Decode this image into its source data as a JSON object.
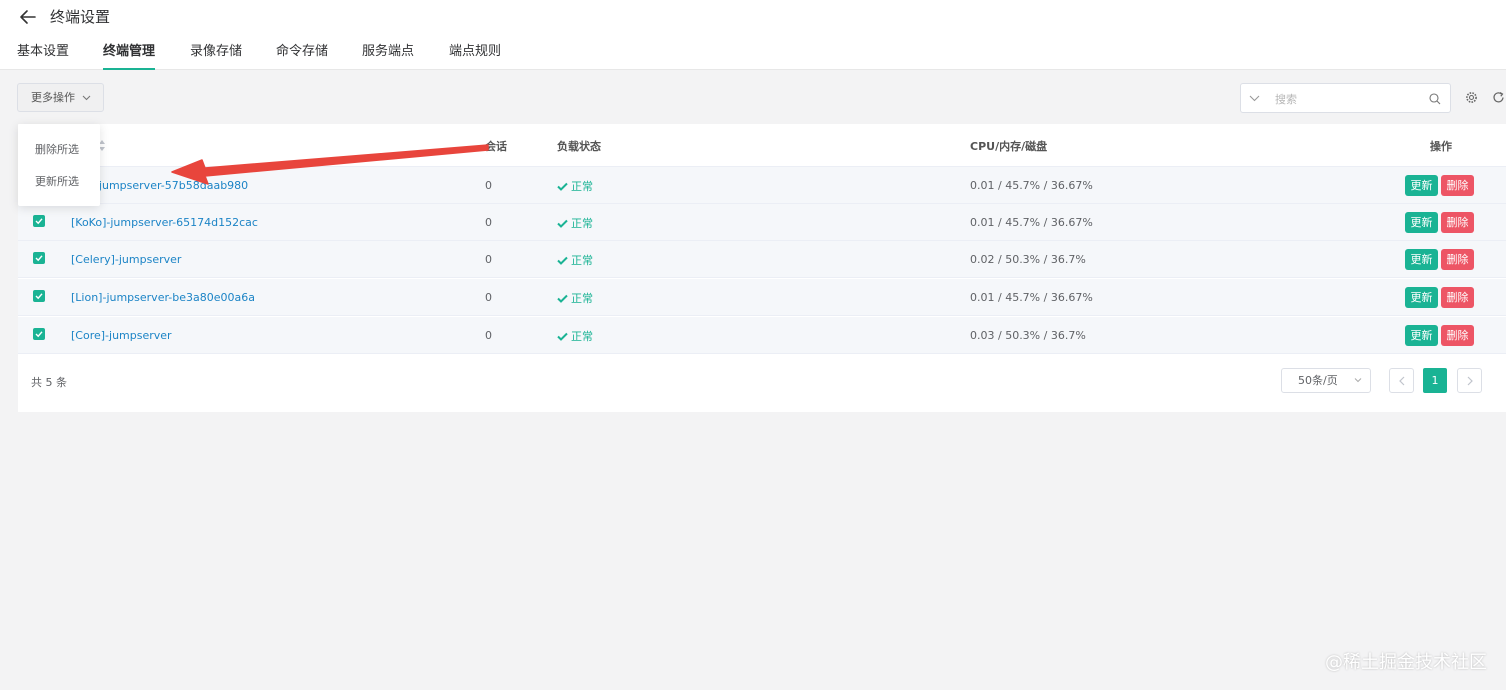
{
  "header": {
    "title": "终端设置",
    "tabs": [
      "基本设置",
      "终端管理",
      "录像存储",
      "命令存储",
      "服务端点",
      "端点规则"
    ],
    "active_tab": "终端管理"
  },
  "toolbar": {
    "more_actions_label": "更多操作",
    "search_placeholder": "搜索"
  },
  "dropdown": {
    "items": [
      "删除所选",
      "更新所选"
    ]
  },
  "table": {
    "columns": {
      "sessions": "会话",
      "status": "负载状态",
      "resources": "CPU/内存/磁盘",
      "actions": "操作"
    },
    "rows": [
      {
        "name": "[Magnus]-jumpserver-57b58daab980",
        "name_visible": "nus]-jumpserver-57b58daab980",
        "sessions": "0",
        "status": "正常",
        "resources": "0.01 / 45.7% / 36.67%",
        "checked": true
      },
      {
        "name": "[KoKo]-jumpserver-65174d152cac",
        "sessions": "0",
        "status": "正常",
        "resources": "0.01 / 45.7% / 36.67%",
        "checked": true
      },
      {
        "name": "[Celery]-jumpserver",
        "sessions": "0",
        "status": "正常",
        "resources": "0.02 / 50.3% / 36.7%",
        "checked": true
      },
      {
        "name": "[Lion]-jumpserver-be3a80e00a6a",
        "sessions": "0",
        "status": "正常",
        "resources": "0.01 / 45.7% / 36.67%",
        "checked": true
      },
      {
        "name": "[Core]-jumpserver",
        "sessions": "0",
        "status": "正常",
        "resources": "0.03 / 50.3% / 36.7%",
        "checked": true
      }
    ],
    "update_label": "更新",
    "delete_label": "删除"
  },
  "pagination": {
    "total": "共 5 条",
    "page_size": "50条/页",
    "current_page": "1"
  },
  "watermark": "@稀土掘金技术社区",
  "colors": {
    "accent": "#1ab394",
    "danger": "#ed5565",
    "link": "#1c84c6",
    "annotation_arrow": "#e8453c"
  }
}
